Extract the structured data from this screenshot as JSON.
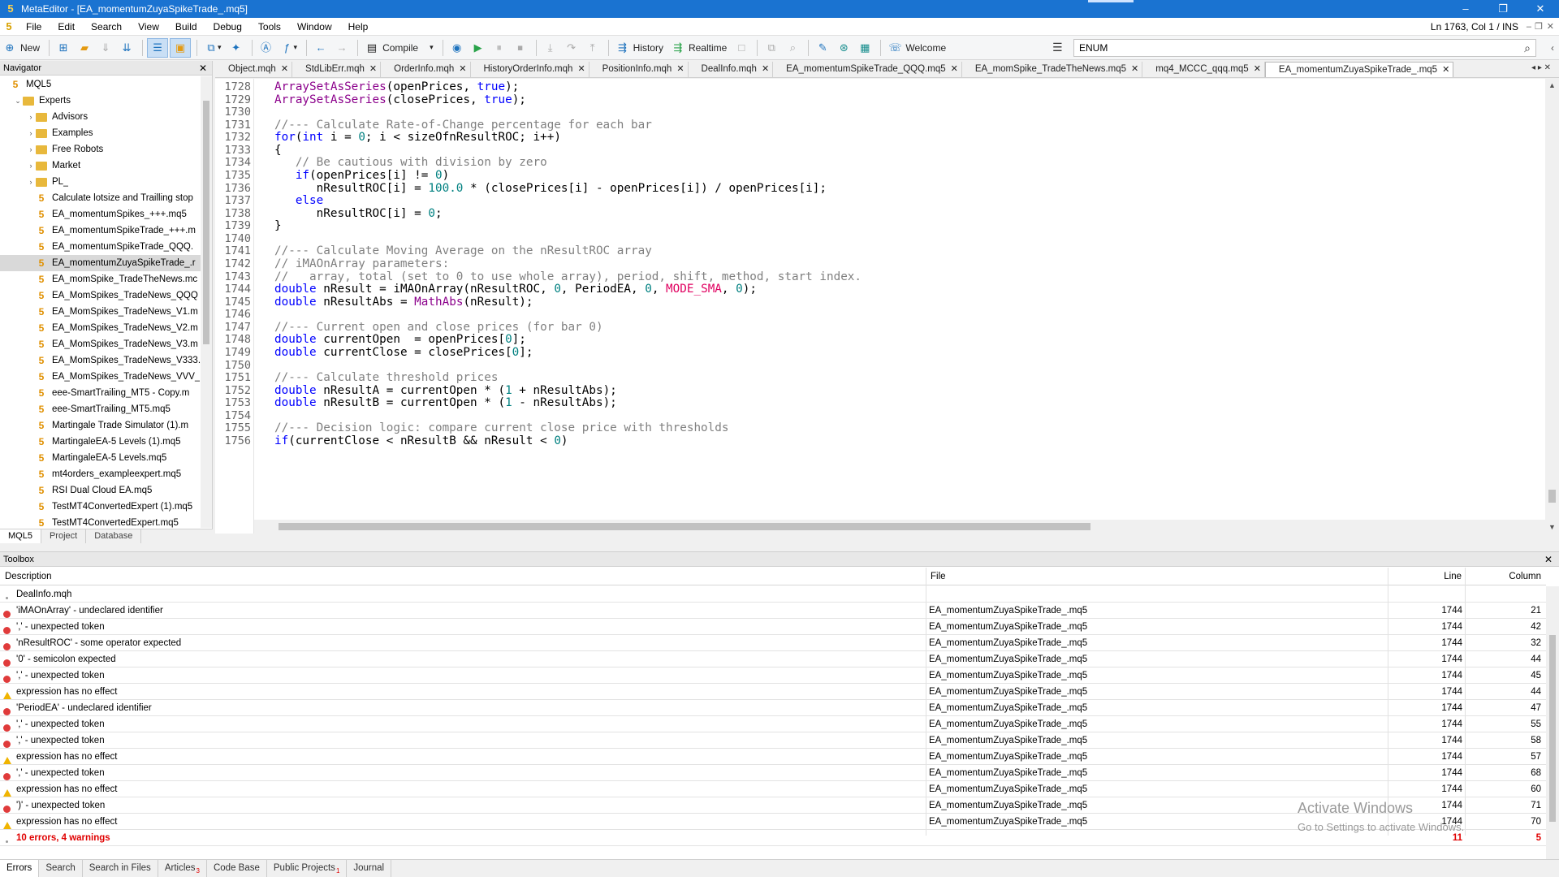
{
  "window": {
    "title": "MetaEditor - [EA_momentumZuyaSpikeTrade_.mq5]",
    "app_icon": "5",
    "minimize": "–",
    "restore": "❐",
    "close": "✕"
  },
  "menu": {
    "items": [
      "File",
      "Edit",
      "Search",
      "View",
      "Build",
      "Debug",
      "Tools",
      "Window",
      "Help"
    ],
    "status": "Ln 1763, Col 1 / INS"
  },
  "toolbar": {
    "new_label": "New",
    "compile_label": "Compile",
    "history_label": "History",
    "realtime_label": "Realtime",
    "welcome_label": "Welcome",
    "search_value": "ENUM"
  },
  "navigator": {
    "title": "Navigator",
    "items": [
      {
        "label": "MQL5",
        "type": "root",
        "level": 0
      },
      {
        "label": "Experts",
        "type": "folder",
        "level": 1,
        "expanded": true
      },
      {
        "label": "Advisors",
        "type": "folder",
        "level": 2
      },
      {
        "label": "Examples",
        "type": "folder",
        "level": 2
      },
      {
        "label": "Free Robots",
        "type": "folder",
        "level": 2
      },
      {
        "label": "Market",
        "type": "folder",
        "level": 2
      },
      {
        "label": "PL_",
        "type": "folder",
        "level": 2
      },
      {
        "label": "Calculate lotsize and Trailling stop",
        "type": "file",
        "level": 2
      },
      {
        "label": "EA_momentumSpikes_+++.mq5",
        "type": "file",
        "level": 2
      },
      {
        "label": "EA_momentumSpikeTrade_+++.m",
        "type": "file",
        "level": 2
      },
      {
        "label": "EA_momentumSpikeTrade_QQQ.",
        "type": "file",
        "level": 2
      },
      {
        "label": "EA_momentumZuyaSpikeTrade_.r",
        "type": "file",
        "level": 2,
        "selected": true
      },
      {
        "label": "EA_momSpike_TradeTheNews.mc",
        "type": "file",
        "level": 2
      },
      {
        "label": "EA_MomSpikes_TradeNews_QQQ",
        "type": "file",
        "level": 2
      },
      {
        "label": "EA_MomSpikes_TradeNews_V1.m",
        "type": "file",
        "level": 2
      },
      {
        "label": "EA_MomSpikes_TradeNews_V2.m",
        "type": "file",
        "level": 2
      },
      {
        "label": "EA_MomSpikes_TradeNews_V3.m",
        "type": "file",
        "level": 2
      },
      {
        "label": "EA_MomSpikes_TradeNews_V333.",
        "type": "file",
        "level": 2
      },
      {
        "label": "EA_MomSpikes_TradeNews_VVV_",
        "type": "file",
        "level": 2
      },
      {
        "label": "eee-SmartTrailing_MT5 - Copy.m",
        "type": "file",
        "level": 2
      },
      {
        "label": "eee-SmartTrailing_MT5.mq5",
        "type": "file",
        "level": 2
      },
      {
        "label": "Martingale Trade Simulator (1).m",
        "type": "file",
        "level": 2
      },
      {
        "label": "MartingaleEA-5 Levels (1).mq5",
        "type": "file",
        "level": 2
      },
      {
        "label": "MartingaleEA-5 Levels.mq5",
        "type": "file",
        "level": 2
      },
      {
        "label": "mt4orders_exampleexpert.mq5",
        "type": "file",
        "level": 2
      },
      {
        "label": "RSI Dual Cloud EA.mq5",
        "type": "file",
        "level": 2
      },
      {
        "label": "TestMT4ConvertedExpert (1).mq5",
        "type": "file",
        "level": 2
      },
      {
        "label": "TestMT4ConvertedExpert.mq5",
        "type": "file",
        "level": 2
      }
    ],
    "tabs": [
      "MQL5",
      "Project",
      "Database"
    ]
  },
  "editor": {
    "tabs": [
      {
        "label": "Object.mqh",
        "active": false
      },
      {
        "label": "StdLibErr.mqh",
        "active": false
      },
      {
        "label": "OrderInfo.mqh",
        "active": false
      },
      {
        "label": "HistoryOrderInfo.mqh",
        "active": false
      },
      {
        "label": "PositionInfo.mqh",
        "active": false
      },
      {
        "label": "DealInfo.mqh",
        "active": false
      },
      {
        "label": "EA_momentumSpikeTrade_QQQ.mq5",
        "active": false
      },
      {
        "label": "EA_momSpike_TradeTheNews.mq5",
        "active": false
      },
      {
        "label": "mq4_MCCC_qqq.mq5",
        "active": false
      },
      {
        "label": "EA_momentumZuyaSpikeTrade_.mq5",
        "active": true
      }
    ],
    "lines": [
      {
        "n": "1728",
        "t": "ArraySetAsSeries(openPrices, true);"
      },
      {
        "n": "1729",
        "t": "ArraySetAsSeries(closePrices, true);"
      },
      {
        "n": "1730",
        "t": ""
      },
      {
        "n": "1731",
        "t": "//--- Calculate Rate-of-Change percentage for each bar"
      },
      {
        "n": "1732",
        "t": "for(int i = 0; i < sizeOfnResultROC; i++)"
      },
      {
        "n": "1733",
        "t": "{"
      },
      {
        "n": "1734",
        "t": "   // Be cautious with division by zero"
      },
      {
        "n": "1735",
        "t": "   if(openPrices[i] != 0)"
      },
      {
        "n": "1736",
        "t": "      nResultROC[i] = 100.0 * (closePrices[i] - openPrices[i]) / openPrices[i];"
      },
      {
        "n": "1737",
        "t": "   else"
      },
      {
        "n": "1738",
        "t": "      nResultROC[i] = 0;"
      },
      {
        "n": "1739",
        "t": "}"
      },
      {
        "n": "1740",
        "t": ""
      },
      {
        "n": "1741",
        "t": "//--- Calculate Moving Average on the nResultROC array"
      },
      {
        "n": "1742",
        "t": "// iMAOnArray parameters:"
      },
      {
        "n": "1743",
        "t": "//   array, total (set to 0 to use whole array), period, shift, method, start index."
      },
      {
        "n": "1744",
        "t": "double nResult = iMAOnArray(nResultROC, 0, PeriodEA, 0, MODE_SMA, 0);"
      },
      {
        "n": "1745",
        "t": "double nResultAbs = MathAbs(nResult);"
      },
      {
        "n": "1746",
        "t": ""
      },
      {
        "n": "1747",
        "t": "//--- Current open and close prices (for bar 0)"
      },
      {
        "n": "1748",
        "t": "double currentOpen  = openPrices[0];"
      },
      {
        "n": "1749",
        "t": "double currentClose = closePrices[0];"
      },
      {
        "n": "1750",
        "t": ""
      },
      {
        "n": "1751",
        "t": "//--- Calculate threshold prices"
      },
      {
        "n": "1752",
        "t": "double nResultA = currentOpen * (1 + nResultAbs);"
      },
      {
        "n": "1753",
        "t": "double nResultB = currentOpen * (1 - nResultAbs);"
      },
      {
        "n": "1754",
        "t": ""
      },
      {
        "n": "1755",
        "t": "//--- Decision logic: compare current close price with thresholds"
      },
      {
        "n": "1756",
        "t": "if(currentClose < nResultB && nResult < 0)"
      }
    ]
  },
  "toolbox": {
    "title": "Toolbox",
    "columns": {
      "description": "Description",
      "file": "File",
      "line": "Line",
      "column": "Column"
    },
    "rows": [
      {
        "type": "info",
        "desc": "DealInfo.mqh",
        "file": "",
        "line": "",
        "col": ""
      },
      {
        "type": "error",
        "desc": "'iMAOnArray' - undeclared identifier",
        "file": "EA_momentumZuyaSpikeTrade_.mq5",
        "line": "1744",
        "col": "21"
      },
      {
        "type": "error",
        "desc": "',' - unexpected token",
        "file": "EA_momentumZuyaSpikeTrade_.mq5",
        "line": "1744",
        "col": "42"
      },
      {
        "type": "error",
        "desc": "'nResultROC' - some operator expected",
        "file": "EA_momentumZuyaSpikeTrade_.mq5",
        "line": "1744",
        "col": "32"
      },
      {
        "type": "error",
        "desc": "'0' - semicolon expected",
        "file": "EA_momentumZuyaSpikeTrade_.mq5",
        "line": "1744",
        "col": "44"
      },
      {
        "type": "error",
        "desc": "',' - unexpected token",
        "file": "EA_momentumZuyaSpikeTrade_.mq5",
        "line": "1744",
        "col": "45"
      },
      {
        "type": "warning",
        "desc": "expression has no effect",
        "file": "EA_momentumZuyaSpikeTrade_.mq5",
        "line": "1744",
        "col": "44"
      },
      {
        "type": "error",
        "desc": "'PeriodEA' - undeclared identifier",
        "file": "EA_momentumZuyaSpikeTrade_.mq5",
        "line": "1744",
        "col": "47"
      },
      {
        "type": "error",
        "desc": "',' - unexpected token",
        "file": "EA_momentumZuyaSpikeTrade_.mq5",
        "line": "1744",
        "col": "55"
      },
      {
        "type": "error",
        "desc": "',' - unexpected token",
        "file": "EA_momentumZuyaSpikeTrade_.mq5",
        "line": "1744",
        "col": "58"
      },
      {
        "type": "warning",
        "desc": "expression has no effect",
        "file": "EA_momentumZuyaSpikeTrade_.mq5",
        "line": "1744",
        "col": "57"
      },
      {
        "type": "error",
        "desc": "',' - unexpected token",
        "file": "EA_momentumZuyaSpikeTrade_.mq5",
        "line": "1744",
        "col": "68"
      },
      {
        "type": "warning",
        "desc": "expression has no effect",
        "file": "EA_momentumZuyaSpikeTrade_.mq5",
        "line": "1744",
        "col": "60"
      },
      {
        "type": "error",
        "desc": "')' - unexpected token",
        "file": "EA_momentumZuyaSpikeTrade_.mq5",
        "line": "1744",
        "col": "71"
      },
      {
        "type": "warning",
        "desc": "expression has no effect",
        "file": "EA_momentumZuyaSpikeTrade_.mq5",
        "line": "1744",
        "col": "70"
      },
      {
        "type": "total",
        "desc": "10 errors, 4 warnings",
        "file": "",
        "line": "11",
        "col": "5"
      }
    ],
    "tabs": [
      {
        "label": "Errors",
        "badge": ""
      },
      {
        "label": "Search",
        "badge": ""
      },
      {
        "label": "Search in Files",
        "badge": ""
      },
      {
        "label": "Articles",
        "badge": "3"
      },
      {
        "label": "Code Base",
        "badge": ""
      },
      {
        "label": "Public Projects",
        "badge": "1"
      },
      {
        "label": "Journal",
        "badge": ""
      }
    ]
  },
  "watermark": {
    "line1": "Activate Windows",
    "line2": "Go to Settings to activate Windows."
  },
  "colors": {
    "title_bar": "#1a73d1",
    "error": "#e03b3b",
    "warning": "#f0b400",
    "keyword": "#0000ff",
    "comment": "#808080",
    "number": "#008080",
    "builtin": "#8b008b"
  }
}
